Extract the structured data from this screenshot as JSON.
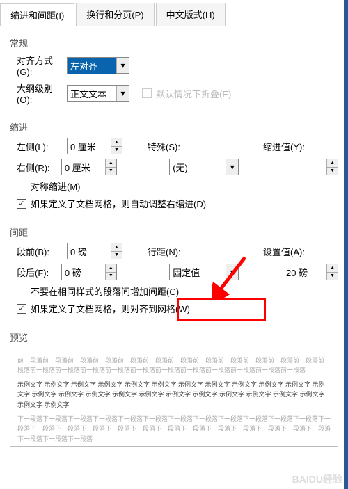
{
  "tabs": {
    "t0": "缩进和间距(I)",
    "t1": "换行和分页(P)",
    "t2": "中文版式(H)"
  },
  "general": {
    "title": "常规",
    "align_label": "对齐方式(G):",
    "align_value": "左对齐",
    "outline_label": "大纲级别(O):",
    "outline_value": "正文文本",
    "collapse_label": "默认情况下折叠(E)"
  },
  "indent": {
    "title": "缩进",
    "left_label": "左侧(L):",
    "left_value": "0 厘米",
    "right_label": "右侧(R):",
    "right_value": "0 厘米",
    "special_label": "特殊(S):",
    "special_value": "(无)",
    "by_label": "缩进值(Y):",
    "by_value": "",
    "mirror_label": "对称缩进(M)",
    "grid_label": "如果定义了文档网格，则自动调整右缩进(D)"
  },
  "spacing": {
    "title": "间距",
    "before_label": "段前(B):",
    "before_value": "0 磅",
    "after_label": "段后(F):",
    "after_value": "0 磅",
    "line_label": "行距(N):",
    "line_value": "固定值",
    "at_label": "设置值(A):",
    "at_value": "20 磅",
    "nospace_label": "不要在相同样式的段落间增加间距(C)",
    "snap_label": "如果定义了文档网格，则对齐到网格(W)"
  },
  "preview": {
    "title": "预览",
    "prev_para": "前一段落前一段落前一段落前一段落前一段落前一段落前一段落前一段落前一段落前一段落前一段落前一段落前一段落前一段落前一段落前一段落前一段落前一段落前一段落前一段落前一段落前一段落前一段落前一段落",
    "sample": "示例文字 示例文字 示例文字 示例文字 示例文字 示例文字 示例文字 示例文字 示例文字 示例文字 示例文字 示例文字 示例文字 示例文字 示例文字 示例文字 示例文字 示例文字 示例文字 示例文字 示例文字 示例文字 示例文字 示例文字 示例文字",
    "next_para": "下一段落下一段落下一段落下一段落下一段落下一段落下一段落下一段落下一段落下一段落下一段落下一段落下一段落下一段落下一段落下一段落下一段落下一段落下一段落下一段落下一段落下一段落下一段落下一段落下一段落下一段落下一段落下一段落"
  },
  "watermark": "BAIDU经验"
}
